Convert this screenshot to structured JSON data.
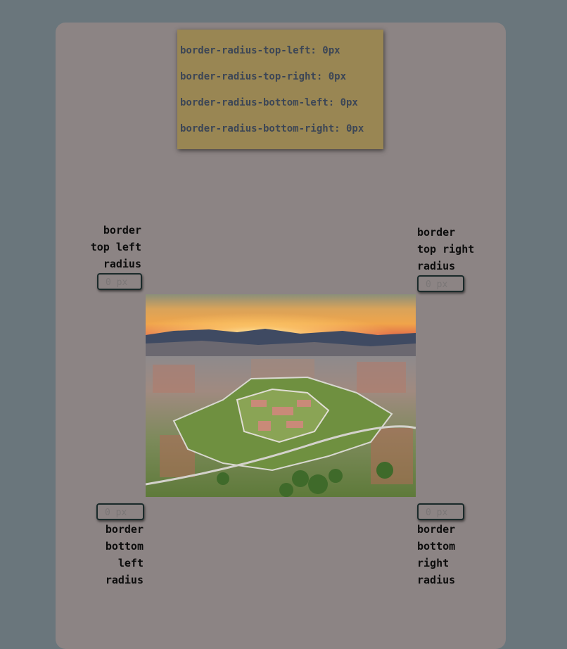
{
  "code_panel": {
    "lines": [
      "border-radius-top-left: 0px",
      "border-radius-top-right: 0px",
      "border-radius-bottom-left: 0px",
      "border-radius-bottom-right: 0px"
    ]
  },
  "controls": {
    "top_left": {
      "label": "border\ntop left\nradius",
      "placeholder": "0 px"
    },
    "top_right": {
      "label": "border\ntop right\nradius",
      "placeholder": "0 px"
    },
    "bottom_left": {
      "label": "border\nbottom\nleft\nradius",
      "placeholder": "0 px"
    },
    "bottom_right": {
      "label": "border\nbottom\nright\nradius",
      "placeholder": "0 px"
    }
  },
  "preview": {
    "image_subject": "aerial photo of star-shaped fortress city at sunset"
  },
  "colors": {
    "page_background": "#6a767c",
    "card_background": "#8c8484",
    "code_panel_background": "#998653",
    "code_text": "#3c4656"
  }
}
